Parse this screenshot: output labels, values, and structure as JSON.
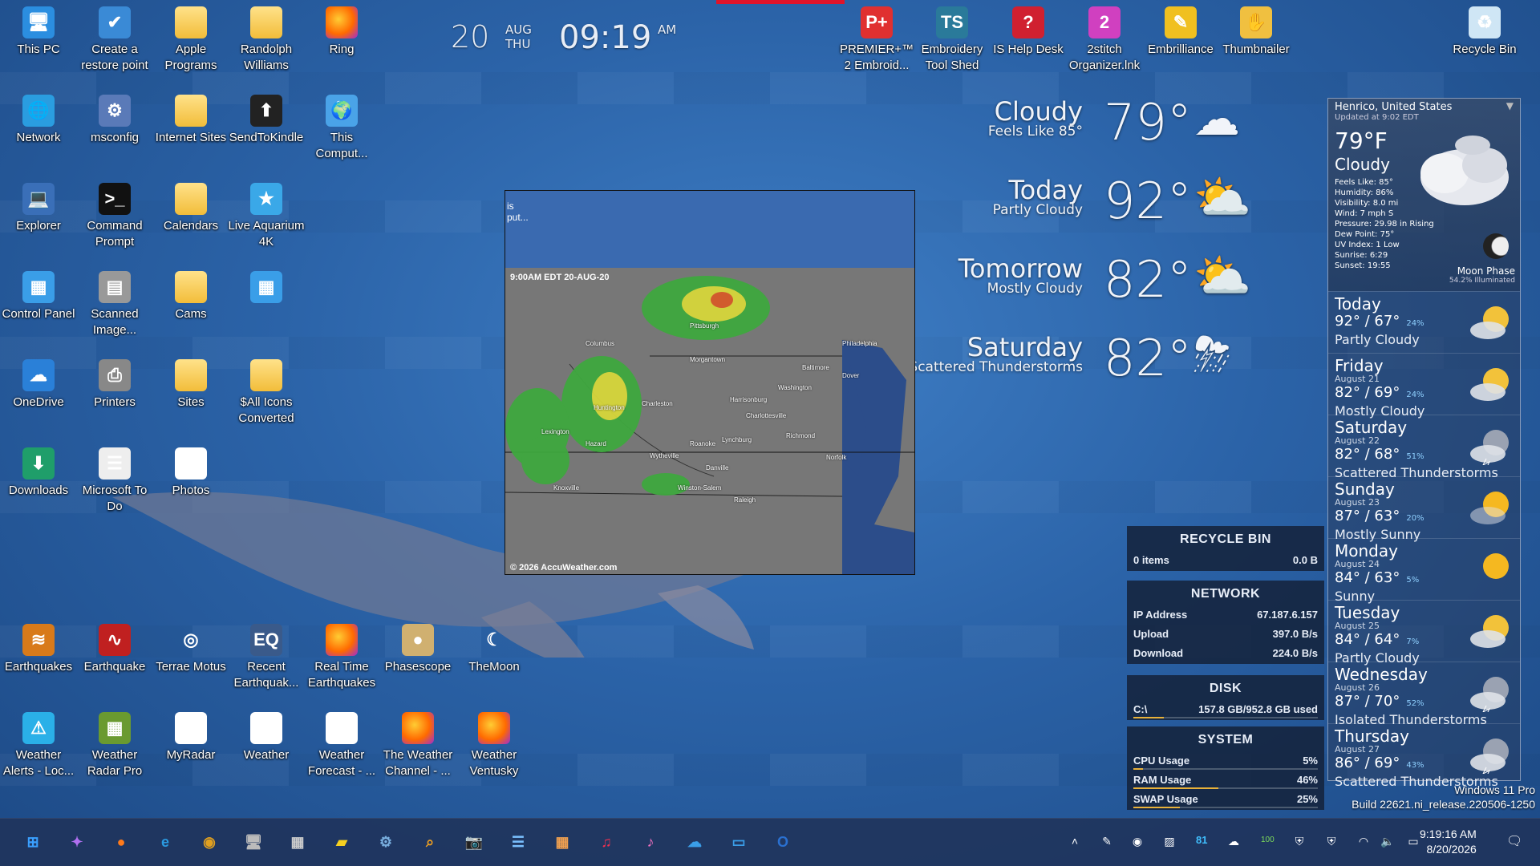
{
  "desktop_icons": [
    {
      "id": "this-pc",
      "label": "This PC",
      "icon": "monitor-icon"
    },
    {
      "id": "create-restore",
      "label": "Create a restore point",
      "icon": "restore-point-icon"
    },
    {
      "id": "apple-programs",
      "label": "Apple Programs",
      "icon": "folder-icon"
    },
    {
      "id": "randolph-williams",
      "label": "Randolph Williams",
      "icon": "folder-icon"
    },
    {
      "id": "ring",
      "label": "Ring",
      "icon": "firefox-icon"
    },
    {
      "id": "network",
      "label": "Network",
      "icon": "network-icon"
    },
    {
      "id": "msconfig",
      "label": "msconfig",
      "icon": "msconfig-icon"
    },
    {
      "id": "internet-sites",
      "label": "Internet Sites",
      "icon": "folder-icon"
    },
    {
      "id": "sendtokindle",
      "label": "SendToKindle",
      "icon": "kindle-icon"
    },
    {
      "id": "this-computer",
      "label": "This Comput...",
      "icon": "globe-icon"
    },
    {
      "id": "explorer",
      "label": "Explorer",
      "icon": "explorer-icon"
    },
    {
      "id": "command-prompt",
      "label": "Command Prompt",
      "icon": "terminal-icon"
    },
    {
      "id": "calendars",
      "label": "Calendars",
      "icon": "folder-icon"
    },
    {
      "id": "live-aquarium",
      "label": "Live Aquarium 4K",
      "icon": "star-icon"
    },
    {
      "id": "control-panel",
      "label": "Control Panel",
      "icon": "control-panel-icon"
    },
    {
      "id": "scanned-image",
      "label": "Scanned Image...",
      "icon": "scanner-icon"
    },
    {
      "id": "cams",
      "label": "Cams",
      "icon": "folder-icon"
    },
    {
      "id": "control-panel-2",
      "label": "",
      "icon": "control-panel-icon"
    },
    {
      "id": "onedrive",
      "label": "OneDrive",
      "icon": "cloud-icon"
    },
    {
      "id": "printers",
      "label": "Printers",
      "icon": "printer-icon"
    },
    {
      "id": "sites",
      "label": "Sites",
      "icon": "folder-icon"
    },
    {
      "id": "all-icons",
      "label": "$All Icons Converted",
      "icon": "folder-icon"
    },
    {
      "id": "downloads",
      "label": "Downloads",
      "icon": "download-icon"
    },
    {
      "id": "ms-todo",
      "label": "Microsoft To Do",
      "icon": "todo-icon"
    },
    {
      "id": "photos",
      "label": "Photos",
      "icon": "document-icon"
    },
    {
      "id": "earthquakes",
      "label": "Earthquakes",
      "icon": "earthquake-icon"
    },
    {
      "id": "earthquake",
      "label": "Earthquake",
      "icon": "seismograph-icon"
    },
    {
      "id": "terrae-motus",
      "label": "Terrae Motus",
      "icon": "target-icon"
    },
    {
      "id": "recent-earthquakes",
      "label": "Recent Earthquak...",
      "icon": "earth-quake-icon"
    },
    {
      "id": "realtime-earthquakes",
      "label": "Real Time Earthquakes",
      "icon": "firefox-icon"
    },
    {
      "id": "phasescope",
      "label": "Phasescope",
      "icon": "moon-icon"
    },
    {
      "id": "themoon",
      "label": "TheMoon",
      "icon": "crescent-icon"
    },
    {
      "id": "weather-alerts",
      "label": "Weather Alerts - Loc...",
      "icon": "weather-alerts-icon"
    },
    {
      "id": "weather-radar-pro",
      "label": "Weather Radar Pro",
      "icon": "radar-icon"
    },
    {
      "id": "myradar",
      "label": "MyRadar",
      "icon": "document-icon"
    },
    {
      "id": "weather",
      "label": "Weather",
      "icon": "document-icon"
    },
    {
      "id": "weather-forecast",
      "label": "Weather Forecast - ...",
      "icon": "document-icon"
    },
    {
      "id": "weather-channel",
      "label": "The Weather Channel - ...",
      "icon": "firefox-icon"
    },
    {
      "id": "weather-ventusky",
      "label": "Weather Ventusky",
      "icon": "firefox-icon"
    },
    {
      "id": "premier",
      "label": "PREMIER+™ 2 Embroid...",
      "icon": "premier-icon"
    },
    {
      "id": "embroidery-toolshed",
      "label": "Embroidery Tool Shed",
      "icon": "ets-icon"
    },
    {
      "id": "is-help-desk",
      "label": "IS Help Desk",
      "icon": "help-desk-icon"
    },
    {
      "id": "2stitch",
      "label": "2stitch Organizer.lnk",
      "icon": "stitch-icon"
    },
    {
      "id": "embrilliance",
      "label": "Embrilliance",
      "icon": "embrilliance-icon"
    },
    {
      "id": "thumbnailer",
      "label": "Thumbnailer",
      "icon": "thumbnailer-icon"
    },
    {
      "id": "recycle-bin",
      "label": "Recycle Bin",
      "icon": "recycle-bin-icon"
    }
  ],
  "clock": {
    "day": "20",
    "month": "AUG",
    "weekday": "THU",
    "time": "09:19",
    "ampm": "AM"
  },
  "weather_widget": {
    "rows": [
      {
        "cond": "Cloudy",
        "sub": "Feels Like 85°",
        "temp": "79°",
        "icon": "cloudy-icon"
      },
      {
        "cond": "Today",
        "sub": "Partly Cloudy",
        "temp": "92°",
        "icon": "partly-cloudy-icon"
      },
      {
        "cond": "Tomorrow",
        "sub": "Mostly Cloudy",
        "temp": "82°",
        "icon": "mostly-cloudy-icon"
      },
      {
        "cond": "Saturday",
        "sub": "Scattered Thunderstorms",
        "temp": "82°",
        "icon": "thunderstorm-icon"
      }
    ]
  },
  "radar": {
    "top_line1": "is",
    "top_line2": "put...",
    "timestamp": "9:00AM EDT 20-AUG-20",
    "copyright": "© 2026 AccuWeather.com",
    "cities": [
      "Columbus",
      "Pittsburgh",
      "Philadelphia",
      "Morgantown",
      "Baltimore",
      "Dover",
      "Washington",
      "Huntington",
      "Charleston",
      "Lexington",
      "Harrisonburg",
      "Charlottesville",
      "Richmond",
      "Roanoke",
      "Lynchburg",
      "Wytheville",
      "Danville",
      "Norfolk",
      "Knoxville",
      "Winston-Salem",
      "Raleigh",
      "Hazard"
    ]
  },
  "monitor": {
    "recycle": {
      "title": "RECYCLE BIN",
      "items": "0 items",
      "size": "0.0 B"
    },
    "network": {
      "title": "NETWORK",
      "ip_label": "IP Address",
      "ip": "67.187.6.157",
      "up_label": "Upload",
      "up": "397.0 B/s",
      "down_label": "Download",
      "down": "224.0 B/s"
    },
    "disk": {
      "title": "DISK",
      "drive": "C:\\",
      "usage": "157.8 GB/952.8 GB used",
      "fraction": 0.166
    },
    "system": {
      "title": "SYSTEM",
      "cpu_label": "CPU Usage",
      "cpu": "5%",
      "cpu_frac": 0.05,
      "ram_label": "RAM Usage",
      "ram": "46%",
      "ram_frac": 0.46,
      "swap_label": "SWAP Usage",
      "swap": "25%",
      "swap_frac": 0.25
    }
  },
  "sidebar": {
    "location": "Henrico, United States",
    "updated": "Updated at 9:02 EDT",
    "temp": "79°F",
    "cond": "Cloudy",
    "details": [
      "Feels Like: 85°",
      "Humidity: 86%",
      "Visibility: 8.0 mi",
      "Wind: 7 mph S",
      "Pressure: 29.98 in Rising",
      "Dew Point: 75°",
      "UV Index: 1 Low",
      "Sunrise: 6:29",
      "Sunset: 19:55"
    ],
    "moon_label": "Moon Phase",
    "moon_sub": "54.2% Illuminated",
    "days": [
      {
        "name": "Today",
        "date": "",
        "hl": "92° / 67°",
        "pop": "24%",
        "cond": "Partly Cloudy",
        "icon": "partly-cloudy-icon"
      },
      {
        "name": "Friday",
        "date": "August 21",
        "hl": "82° / 69°",
        "pop": "24%",
        "cond": "Mostly Cloudy",
        "icon": "mostly-cloudy-icon"
      },
      {
        "name": "Saturday",
        "date": "August 22",
        "hl": "82° / 68°",
        "pop": "51%",
        "cond": "Scattered Thunderstorms",
        "icon": "thunderstorm-icon"
      },
      {
        "name": "Sunday",
        "date": "August 23",
        "hl": "87° / 63°",
        "pop": "20%",
        "cond": "Mostly Sunny",
        "icon": "mostly-sunny-icon"
      },
      {
        "name": "Monday",
        "date": "August 24",
        "hl": "84° / 63°",
        "pop": "5%",
        "cond": "Sunny",
        "icon": "sunny-icon"
      },
      {
        "name": "Tuesday",
        "date": "August 25",
        "hl": "84° / 64°",
        "pop": "7%",
        "cond": "Partly Cloudy",
        "icon": "partly-cloudy-icon"
      },
      {
        "name": "Wednesday",
        "date": "August 26",
        "hl": "87° / 70°",
        "pop": "52%",
        "cond": "Isolated Thunderstorms",
        "icon": "thunderstorm-icon"
      },
      {
        "name": "Thursday",
        "date": "August 27",
        "hl": "86° / 69°",
        "pop": "43%",
        "cond": "Scattered Thunderstorms",
        "icon": "thunderstorm-icon"
      }
    ]
  },
  "windows_version": {
    "line1": "Windows 11 Pro",
    "line2": "Build 22621.ni_release.220506-1250"
  },
  "taskbar": {
    "apps": [
      "start-icon",
      "copilot-icon",
      "firefox-icon",
      "edge-icon",
      "chrome-icon",
      "computer-icon",
      "calculator-icon",
      "sticky-notes-icon",
      "settings-icon",
      "search-icon",
      "camera-icon",
      "notepad-icon",
      "store-icon",
      "music-icon",
      "itunes-icon",
      "icloud-icon",
      "desktop-icon",
      "outlook-icon"
    ],
    "tray": [
      "chevron-up-icon",
      "pen-icon",
      "globe-icon",
      "photos-icon",
      "calendar-icon",
      "weather-icon",
      "battery-widget-icon",
      "defender-icon",
      "shield-icon",
      "wifi-icon",
      "volume-icon",
      "battery-icon"
    ],
    "tray_text": "100",
    "cal_text": "81",
    "time": "9:19:16 AM",
    "date": "8/20/2026"
  }
}
